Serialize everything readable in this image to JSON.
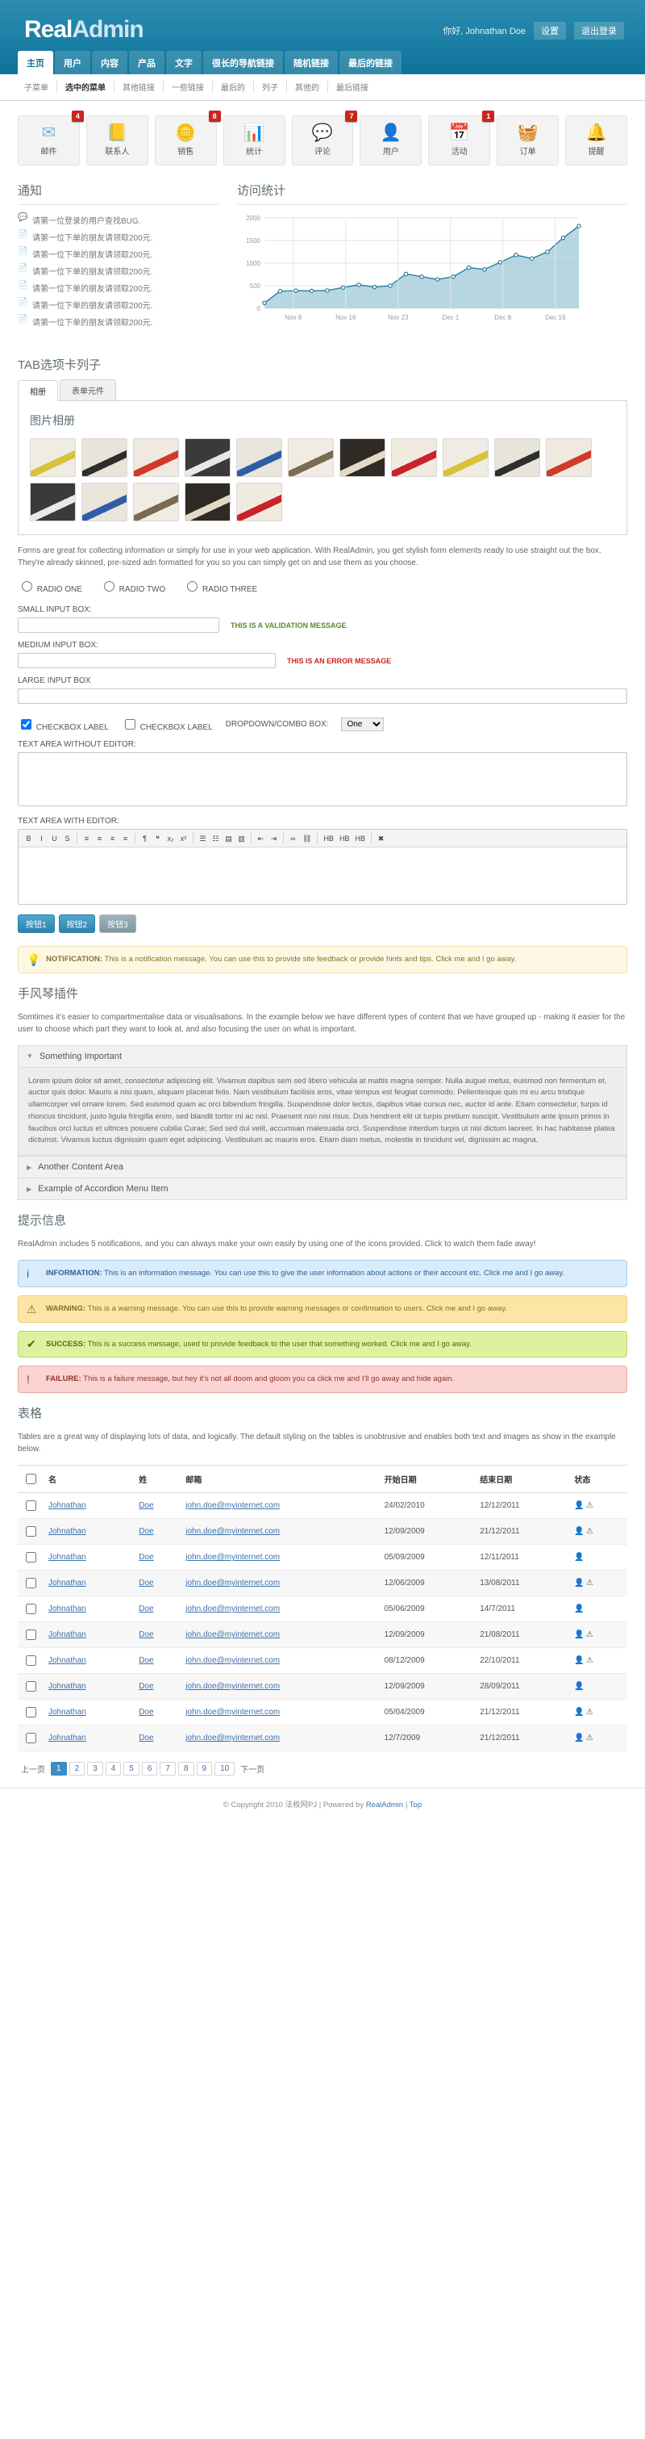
{
  "header": {
    "logo_bold": "Real",
    "logo_light": "Admin",
    "greeting": "你好, Johnathan Doe",
    "settings_label": "设置",
    "logout_label": "退出登录",
    "nav": [
      {
        "label": "主页",
        "active": true
      },
      {
        "label": "用户",
        "active": false
      },
      {
        "label": "内容",
        "active": false
      },
      {
        "label": "产品",
        "active": false
      },
      {
        "label": "文字",
        "active": false
      },
      {
        "label": "很长的导航链接",
        "active": false
      },
      {
        "label": "随机链接",
        "active": false
      },
      {
        "label": "最后的链接",
        "active": false
      }
    ],
    "subnav": [
      {
        "label": "子菜单",
        "active": false
      },
      {
        "label": "选中的菜单",
        "active": true
      },
      {
        "label": "其他链接",
        "active": false
      },
      {
        "label": "一些链接",
        "active": false
      },
      {
        "label": "最后的",
        "active": false
      },
      {
        "label": "列子",
        "active": false
      },
      {
        "label": "其他的",
        "active": false
      },
      {
        "label": "最后链接",
        "active": false
      }
    ]
  },
  "tiles": [
    {
      "label": "邮件",
      "icon": "envelope-icon",
      "glyph": "✉",
      "color": "#7fb4d4",
      "badge": "4"
    },
    {
      "label": "联系人",
      "icon": "address-book-icon",
      "glyph": "📒",
      "color": "#b5803c",
      "badge": ""
    },
    {
      "label": "销售",
      "icon": "coins-icon",
      "glyph": "🪙",
      "color": "#e0b43a",
      "badge": "8"
    },
    {
      "label": "统计",
      "icon": "bar-chart-icon",
      "glyph": "📊",
      "color": "#d04a36",
      "badge": ""
    },
    {
      "label": "评论",
      "icon": "speech-bubble-icon",
      "glyph": "💬",
      "color": "#8fc3de",
      "badge": "7"
    },
    {
      "label": "用户",
      "icon": "user-icon",
      "glyph": "👤",
      "color": "#4c8fc0",
      "badge": ""
    },
    {
      "label": "活动",
      "icon": "calendar-icon",
      "glyph": "📅",
      "color": "#c24a3b",
      "badge": "1"
    },
    {
      "label": "订单",
      "icon": "basket-icon",
      "glyph": "🧺",
      "color": "#6f9ec4",
      "badge": ""
    },
    {
      "label": "提醒",
      "icon": "bell-icon",
      "glyph": "🔔",
      "color": "#d9ad33",
      "badge": ""
    }
  ],
  "notifications": {
    "title": "通知",
    "items": [
      {
        "icon": "comment-add-icon",
        "text": "请第一位登录的用户查找BUG."
      },
      {
        "icon": "page-add-icon",
        "text": "请第一位下单的朋友请领取200元."
      },
      {
        "icon": "page-add-icon",
        "text": "请第一位下单的朋友请领取200元."
      },
      {
        "icon": "page-add-icon",
        "text": "请第一位下单的朋友请领取200元."
      },
      {
        "icon": "page-add-icon",
        "text": "请第一位下单的朋友请领取200元."
      },
      {
        "icon": "page-add-icon",
        "text": "请第一位下单的朋友请领取200元."
      },
      {
        "icon": "page-add-icon",
        "text": "请第一位下单的朋友请领取200元."
      }
    ]
  },
  "chart_panel": {
    "title": "访问统计"
  },
  "chart_data": {
    "type": "area",
    "title": "访问统计",
    "xlabel": "",
    "ylabel": "",
    "ylim": [
      0,
      2000
    ],
    "yticks": [
      0,
      500,
      1000,
      1500,
      2000
    ],
    "xticks": [
      "Nov 8",
      "Nov 16",
      "Nov 23",
      "Dec 1",
      "Dec 8",
      "Dec 16"
    ],
    "grid": true,
    "legend": "none",
    "series": [
      {
        "name": "访问量",
        "x": [
          "Nov 5",
          "Nov 8",
          "Nov 11",
          "Nov 14",
          "Nov 16",
          "Nov 19",
          "Nov 21",
          "Nov 23",
          "Nov 25",
          "Nov 27",
          "Nov 29",
          "Dec 1",
          "Dec 3",
          "Dec 5",
          "Dec 8",
          "Dec 10",
          "Dec 12",
          "Dec 14",
          "Dec 16",
          "Dec 18",
          "Dec 20"
        ],
        "values": [
          120,
          380,
          390,
          385,
          395,
          460,
          520,
          470,
          500,
          760,
          700,
          640,
          700,
          900,
          860,
          1020,
          1180,
          1100,
          1250,
          1560,
          1820
        ]
      }
    ]
  },
  "tab_section": {
    "title": "TAB选项卡列子",
    "tabs": [
      {
        "label": "相册",
        "active": true
      },
      {
        "label": "表单元件",
        "active": false
      }
    ],
    "gallery_title": "图片相册",
    "gallery_count": 16,
    "intro": "Forms are great for collecting information or simply for use in your web application. With RealAdmin, you get stylish form elements ready to use straight out the box. They're already skinned, pre-sized adn formatted for you so you can simply get on and use them as you choose."
  },
  "form": {
    "radios": [
      "RADIO ONE",
      "RADIO TWO",
      "RADIO THREE"
    ],
    "small_label": "SMALL INPUT BOX:",
    "small_value": "",
    "small_placeholder": "",
    "validation_message": "THIS IS A VALIDATION MESSAGE",
    "medium_label": "MEDIUM INPUT BOX:",
    "medium_value": "",
    "error_message": "THIS IS AN ERROR MESSAGE",
    "large_label": "LARGE INPUT BOX",
    "large_value": "",
    "checkbox_one": "CHECKBOX LABEL",
    "checkbox_two": "CHECKBOX LABEL",
    "dropdown_label": "DROPDOWN/COMBO BOX:",
    "dropdown_value": "One",
    "dropdown_options": [
      "One",
      "Two",
      "Three"
    ],
    "textarea_label": "TEXT AREA WITHOUT EDITOR:",
    "textarea_value": "",
    "editor_label": "TEXT AREA WITH EDITOR:",
    "editor_value": "",
    "buttons": [
      {
        "label": "按钮1",
        "style": "primary"
      },
      {
        "label": "按钮2",
        "style": "primary"
      },
      {
        "label": "按钮3",
        "style": "alt"
      }
    ]
  },
  "editor_toolbar": {
    "groups": [
      [
        "B",
        "I",
        "U",
        "S"
      ],
      [
        "≡",
        "≡",
        "≡",
        "≡"
      ],
      [
        "¶",
        "❝",
        "x₂",
        "x²"
      ],
      [
        "☰",
        "☷",
        "▤",
        "▥"
      ],
      [
        "⇤",
        "⇥"
      ],
      [
        "∞",
        "⛓"
      ],
      [
        "HB",
        "HB",
        "HB"
      ],
      [
        "✖"
      ]
    ]
  },
  "notification_alert": {
    "icon": "lightbulb-icon",
    "bold": "NOTIFICATION:",
    "text": "This is a notification message. You can use this to provide site feedback or provide hints and tips. Click me and I go away."
  },
  "accordion": {
    "title": "手风琴插件",
    "intro": "Somtimes it's easier to compartmentalise data or visualisations. In the example below we have different types of content that we have grouped up - making it easier for the user to choose which part they want to look at, and also focusing the user on what is important.",
    "items": [
      {
        "label": "Something Important",
        "open": true,
        "body": "Lorem ipsum dolor sit amet, consectetur adipiscing elit. Vivamus dapibus sem sed libero vehicula at mattis magna semper. Nulla augue metus, euismod non fermentum et, auctor quis dolor. Mauris a nisi quam, aliquam placerat felis. Nam vestibulum facilisis eros, vitae tempus est feugiat commodo. Pellentesque quis mi eu arcu tristique ullamcorper vel ornare lorem. Sed euismod quam ac orci bibendum fringilla. Suspendisse dolor lectus, dapibus vitae cursus nec, auctor id ante. Etiam consectetur, turpis id rhoncus tincidunt, justo ligula fringilla enim, sed blandit tortor mi ac nisl. Praesent non nisi risus. Duis hendrerit elit ut turpis pretium suscipit. Vestibulum ante ipsum primis in faucibus orci luctus et ultrices posuere cubilia Curae; Sed sed dui velit, accumsan malesuada orci. Suspendisse interdum turpis ut nisi dictum laoreet. In hac habitasse platea dictumst. Vivamus luctus dignissim quam eget adipiscing. Vestibulum ac mauris eros. Etiam diam metus, molestie in tincidunt vel, dignissim ac magna."
      },
      {
        "label": "Another Content Area",
        "open": false,
        "body": ""
      },
      {
        "label": "Example of Accordion Menu Item",
        "open": false,
        "body": ""
      }
    ]
  },
  "messages": {
    "title": "提示信息",
    "intro": "RealAdmin includes 5 notifications, and you can always make your own easily by using one of the icons provided. Click to watch them fade away!",
    "items": [
      {
        "type": "info",
        "icon": "info-icon",
        "glyph": "i",
        "bold": "INFORMATION:",
        "text": "This is an information message. You can use this to give the user information about actions or their account etc. Click me and I go away."
      },
      {
        "type": "warn",
        "icon": "warning-triangle-icon",
        "glyph": "⚠",
        "bold": "WARNING:",
        "text": "This is a warning message. You can use this to provide warning messages or confirmation to users. Click me and I go away."
      },
      {
        "type": "succ",
        "icon": "check-circle-icon",
        "glyph": "✔",
        "bold": "SUCCESS:",
        "text": "This is a success message, used to provide feedback to the user that something worked. Click me and I go away."
      },
      {
        "type": "fail",
        "icon": "error-circle-icon",
        "glyph": "!",
        "bold": "FAILURE:",
        "text": "This is a failure message, but hey it's not all doom and gloom you ca click me and I'll go away and hide again."
      }
    ]
  },
  "table_section": {
    "title": "表格",
    "intro": "Tables are a great way of displaying lots of data, and logically. The default styling on the tables is unobtrusive and enables both text and images as show in the example below.",
    "columns": [
      "",
      "名",
      "姓",
      "邮箱",
      "开始日期",
      "结束日期",
      "状态"
    ],
    "rows": [
      {
        "first": "Johnathan",
        "last": "Doe",
        "email": "john.doe@myinternet.com",
        "start": "24/02/2010",
        "end": "12/12/2011",
        "status": [
          "user",
          "alert"
        ]
      },
      {
        "first": "Johnathan",
        "last": "Doe",
        "email": "john.doe@myinternet.com",
        "start": "12/09/2009",
        "end": "21/12/2011",
        "status": [
          "user",
          "alert"
        ]
      },
      {
        "first": "Johnathan",
        "last": "Doe",
        "email": "john.doe@myinternet.com",
        "start": "05/09/2009",
        "end": "12/11/2011",
        "status": [
          "user"
        ]
      },
      {
        "first": "Johnathan",
        "last": "Doe",
        "email": "john.doe@myinternet.com",
        "start": "12/06/2009",
        "end": "13/08/2011",
        "status": [
          "user",
          "alert"
        ]
      },
      {
        "first": "Johnathan",
        "last": "Doe",
        "email": "john.doe@myinternet.com",
        "start": "05/06/2009",
        "end": "14/7/2011",
        "status": [
          "user"
        ]
      },
      {
        "first": "Johnathan",
        "last": "Doe",
        "email": "john.doe@myinternet.com",
        "start": "12/09/2009",
        "end": "21/08/2011",
        "status": [
          "user",
          "alert"
        ]
      },
      {
        "first": "Johnathan",
        "last": "Doe",
        "email": "john.doe@myinternet.com",
        "start": "08/12/2009",
        "end": "22/10/2011",
        "status": [
          "user",
          "alert"
        ]
      },
      {
        "first": "Johnathan",
        "last": "Doe",
        "email": "john.doe@myinternet.com",
        "start": "12/09/2009",
        "end": "28/09/2011",
        "status": [
          "user"
        ]
      },
      {
        "first": "Johnathan",
        "last": "Doe",
        "email": "john.doe@myinternet.com",
        "start": "05/04/2009",
        "end": "21/12/2011",
        "status": [
          "user",
          "alert"
        ]
      },
      {
        "first": "Johnathan",
        "last": "Doe",
        "email": "john.doe@myinternet.com",
        "start": "12/7/2009",
        "end": "21/12/2011",
        "status": [
          "user",
          "alert"
        ]
      }
    ]
  },
  "pager": {
    "prev": "上一页",
    "next": "下一页",
    "pages": [
      "1",
      "2",
      "3",
      "4",
      "5",
      "6",
      "7",
      "8",
      "9",
      "10"
    ],
    "active": "1"
  },
  "footer": {
    "copyright": "© Copyright 2010 法枚网PJ | Powered by ",
    "brand": "RealAdmin",
    "sep": " | ",
    "top": "Top"
  }
}
